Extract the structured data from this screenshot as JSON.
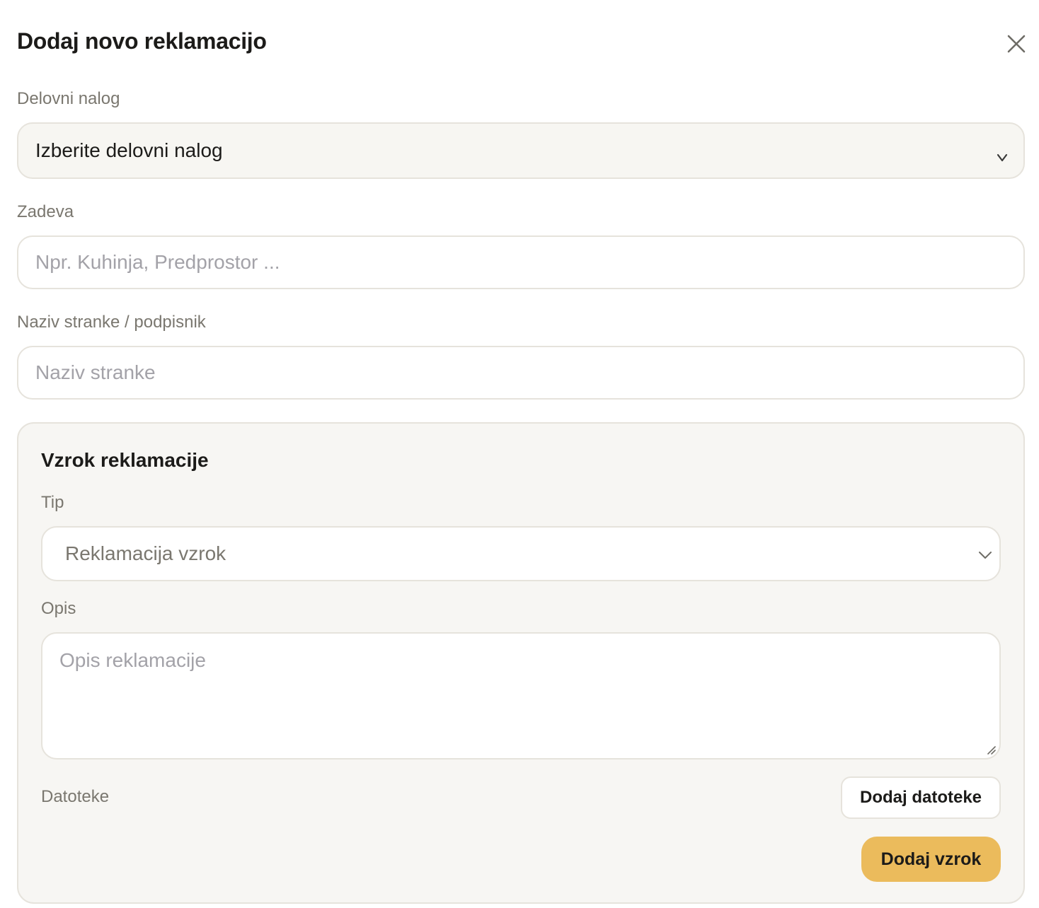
{
  "modal": {
    "title": "Dodaj novo reklamacijo"
  },
  "work_order": {
    "label": "Delovni nalog",
    "selected": "Izberite delovni nalog"
  },
  "subject": {
    "label": "Zadeva",
    "placeholder": "Npr. Kuhinja, Predprostor ...",
    "value": ""
  },
  "customer": {
    "label": "Naziv stranke / podpisnik",
    "placeholder": "Naziv stranke",
    "value": ""
  },
  "cause": {
    "title": "Vzrok reklamacije",
    "type_label": "Tip",
    "type_selected": "Reklamacija vzrok",
    "description_label": "Opis",
    "description_placeholder": "Opis reklamacije",
    "files_label": "Datoteke",
    "add_files_button": "Dodaj datoteke",
    "add_cause_button": "Dodaj vzrok"
  },
  "colors": {
    "accent": "#ebbb5c",
    "border": "#e6e3dc",
    "panel_bg": "#f7f6f3",
    "label_text": "#7a776f",
    "placeholder_text": "#a3a2a8"
  }
}
